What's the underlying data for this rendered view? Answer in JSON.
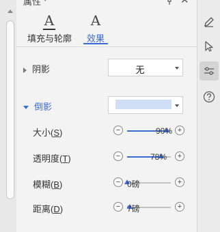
{
  "panel": {
    "title": "属性",
    "title_caret": "▾",
    "close_glyph": "✕"
  },
  "tabs": [
    {
      "label": "填充与轮廓",
      "glyph": "A",
      "active": false
    },
    {
      "label": "效果",
      "glyph": "A",
      "active": true
    }
  ],
  "shadow": {
    "label": "阴影",
    "value": "无"
  },
  "reflection": {
    "label": "倒影",
    "swatch_color": "#cfddf5",
    "rows": [
      {
        "label": "大小",
        "accel": "S",
        "value_text": "90%",
        "level": 0.9
      },
      {
        "label": "透明度",
        "accel": "T",
        "value_text": "78%",
        "level": 0.78
      },
      {
        "label": "模糊",
        "accel": "B",
        "value_text": "0磅",
        "level": 0.0
      },
      {
        "label": "距离",
        "accel": "D",
        "value_text": "7磅",
        "level": 0.07
      }
    ]
  },
  "slider": {
    "minus": "−",
    "plus": "+"
  },
  "rail": {
    "items": [
      {
        "icon": "pen-icon",
        "active": false
      },
      {
        "icon": "cursor-icon",
        "active": false
      },
      {
        "icon": "adjust-icon",
        "active": true
      },
      {
        "icon": "help-icon",
        "active": false
      }
    ]
  },
  "colors": {
    "accent": "#3a6ad8"
  }
}
